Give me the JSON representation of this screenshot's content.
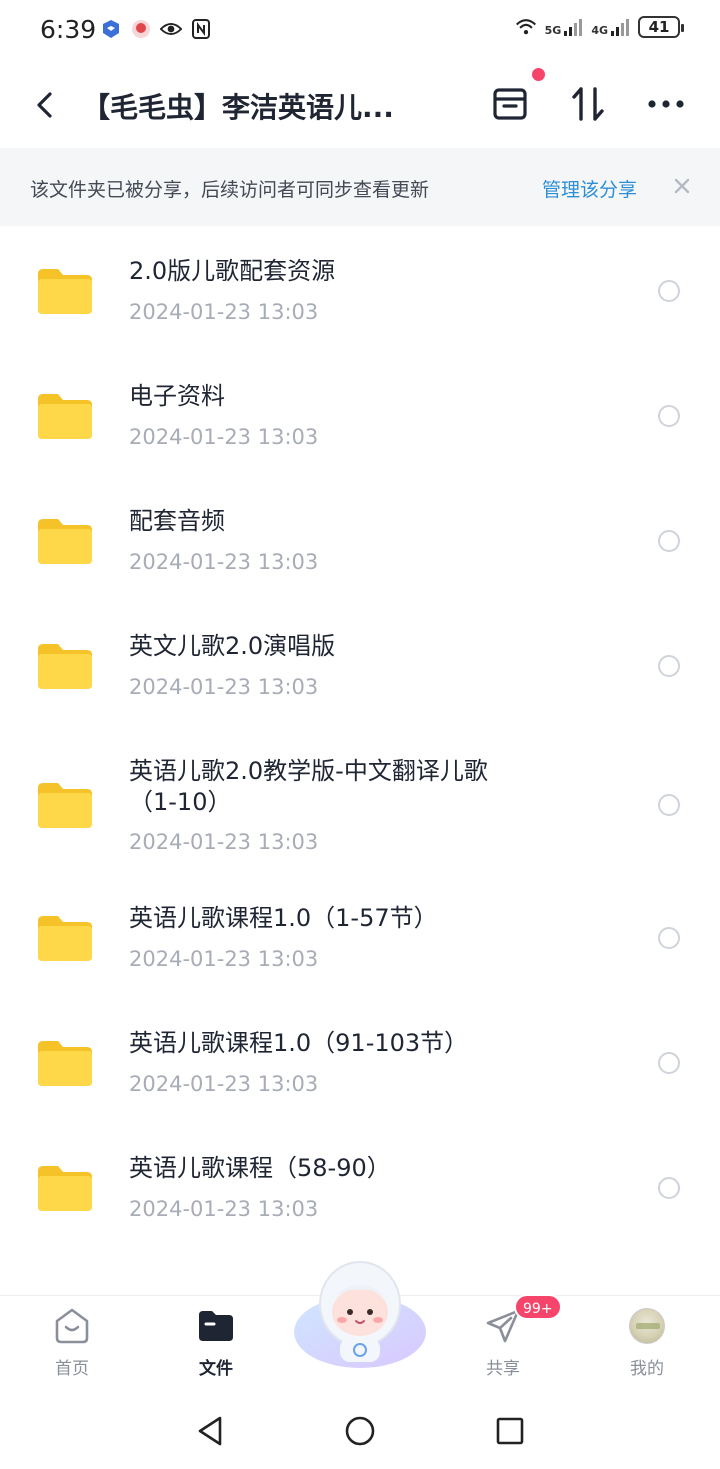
{
  "status_bar": {
    "time": "6:39",
    "network_5g": "5G",
    "network_4g": "4G",
    "battery": "41"
  },
  "header": {
    "title": "【毛毛虫】李洁英语儿...",
    "icons": [
      "back-icon",
      "inbox-icon",
      "sort-icon",
      "more-icon"
    ]
  },
  "share_banner": {
    "text": "该文件夹已被分享，后续访问者可同步查看更新",
    "action": "管理该分享"
  },
  "files": [
    {
      "name": "2.0版儿歌配套资源",
      "time": "2024-01-23  13:03"
    },
    {
      "name": "电子资料",
      "time": "2024-01-23  13:03"
    },
    {
      "name": "配套音频",
      "time": "2024-01-23  13:03"
    },
    {
      "name": "英文儿歌2.0演唱版",
      "time": "2024-01-23  13:03"
    },
    {
      "name": "英语儿歌2.0教学版-中文翻译儿歌（1-10）",
      "time": "2024-01-23  13:03"
    },
    {
      "name": "英语儿歌课程1.0（1-57节）",
      "time": "2024-01-23  13:03"
    },
    {
      "name": "英语儿歌课程1.0（91-103节）",
      "time": "2024-01-23  13:03"
    },
    {
      "name": "英语儿歌课程（58-90）",
      "time": "2024-01-23  13:03"
    }
  ],
  "bottom_nav": {
    "home": "首页",
    "files": "文件",
    "share": "共享",
    "me": "我的",
    "share_badge": "99+"
  },
  "colors": {
    "accent": "#2d8fd5",
    "badge": "#f5456b",
    "folder": "#ffd23f",
    "time_text": "#a7acb6"
  }
}
